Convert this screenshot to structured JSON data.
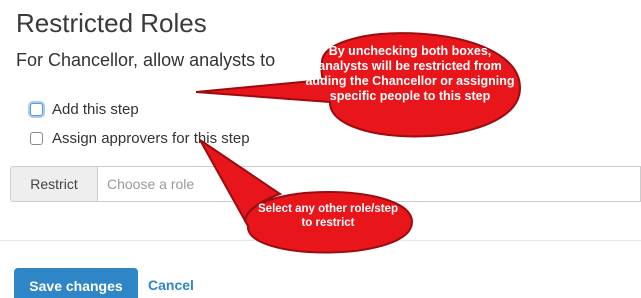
{
  "heading": "Restricted Roles",
  "subheading": "For Chancellor, allow analysts to",
  "options": [
    {
      "label": "Add this step",
      "checked": false,
      "focused": true
    },
    {
      "label": "Assign approvers for this step",
      "checked": false,
      "focused": false
    }
  ],
  "restrict": {
    "label": "Restrict",
    "placeholder": "Choose a role"
  },
  "actions": {
    "save_label": "Save changes",
    "cancel_label": "Cancel"
  },
  "annotations": {
    "callout_1": "By unchecking both boxes, analysts will be restricted from adding the Chancellor or assigning specific people to this step",
    "callout_2": "Select any other role/step to restrict"
  },
  "colors": {
    "primary": "#2f86c6",
    "callout_fill": "#e8161b",
    "callout_border": "#9b0c0f"
  }
}
